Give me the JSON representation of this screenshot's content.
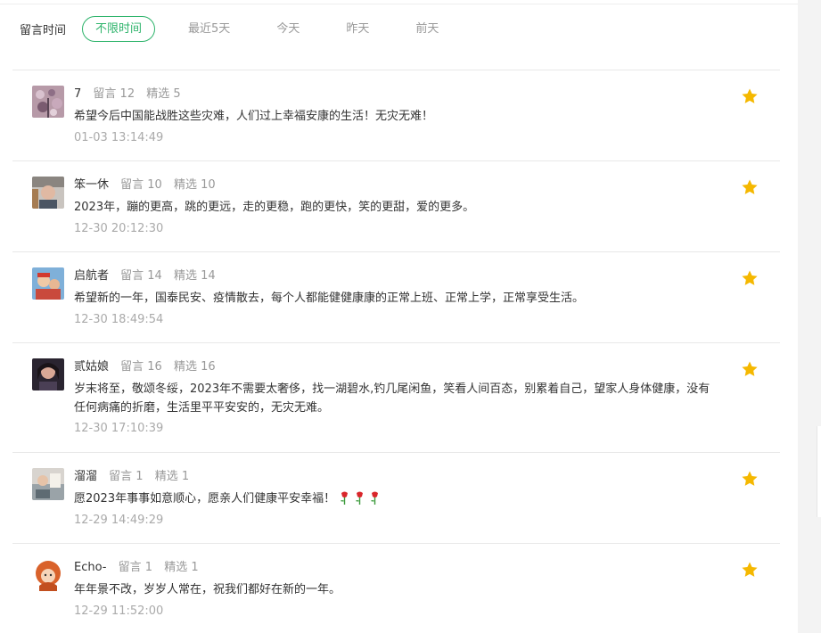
{
  "filter": {
    "label": "留言时间",
    "tabs": [
      "不限时间",
      "最近5天",
      "今天",
      "昨天",
      "前天"
    ],
    "active_index": 0
  },
  "colors": {
    "accent": "#2fb46c",
    "star": "#f5b800",
    "muted": "#999999"
  },
  "comments": [
    {
      "name": "7",
      "messages": "留言 12",
      "featured": "精选 5",
      "text": "希望今后中国能战胜这些灾难，人们过上幸福安康的生活！无灾无难！",
      "time": "01-03 13:14:49",
      "avatar": "avatar-flowers"
    },
    {
      "name": "笨一休",
      "messages": "留言 10",
      "featured": "精选 10",
      "text": "2023年，蹦的更高，跳的更远，走的更稳，跑的更快，笑的更甜，爱的更多。",
      "time": "12-30 20:12:30",
      "avatar": "avatar-person"
    },
    {
      "name": "启航者",
      "messages": "留言 14",
      "featured": "精选 14",
      "text": "希望新的一年，国泰民安、疫情散去，每个人都能健健康康的正常上班、正常上学，正常享受生活。",
      "time": "12-30 18:49:54",
      "avatar": "avatar-children"
    },
    {
      "name": "贰姑娘",
      "messages": "留言 16",
      "featured": "精选 16",
      "text": "岁末将至，敬颂冬绥，2023年不需要太奢侈，找一湖碧水,钓几尾闲鱼，笑看人间百态，别累着自己，望家人身体健康，没有任何病痛的折磨，生活里平平安安的，无灾无难。",
      "time": "12-30 17:10:39",
      "avatar": "avatar-dark-portrait"
    },
    {
      "name": "溜溜",
      "messages": "留言 1",
      "featured": "精选 1",
      "text": "愿2023年事事如意顺心，愿亲人们健康平安幸福！",
      "emoji": [
        "rose-icon",
        "rose-icon",
        "rose-icon"
      ],
      "time": "12-29 14:49:29",
      "avatar": "avatar-photo"
    },
    {
      "name": "Echo-",
      "messages": "留言 1",
      "featured": "精选 1",
      "text": "年年景不改，岁岁人常在，祝我们都好在新的一年。",
      "time": "12-29 11:52:00",
      "avatar": "avatar-cartoon-girl"
    }
  ]
}
